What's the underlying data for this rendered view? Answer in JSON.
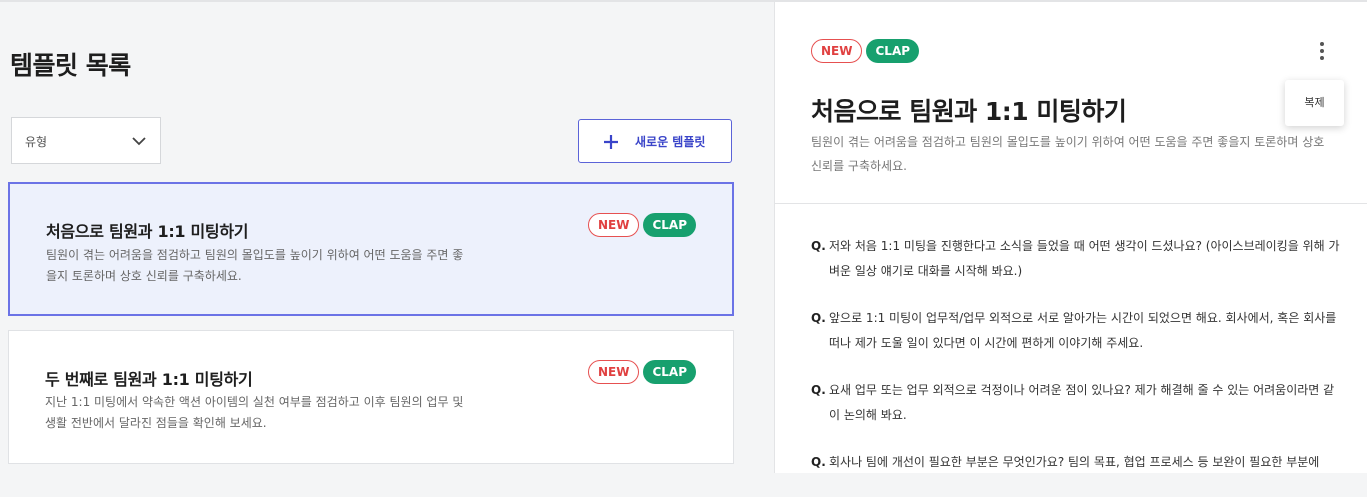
{
  "left": {
    "title": "템플릿 목록",
    "type_select": {
      "label": "유형"
    },
    "new_button": {
      "label": "새로운 템플릿"
    },
    "cards": [
      {
        "title": "처음으로 팀원과 1:1 미팅하기",
        "description": "팀원이 겪는 어려움을 점검하고 팀원의 몰입도를 높이기 위하여 어떤 도움을 주면 좋을지 토론하며 상호 신뢰를 구축하세요.",
        "badge_new": "NEW",
        "badge_clap": "CLAP",
        "selected": true
      },
      {
        "title": "두 번째로 팀원과 1:1 미팅하기",
        "description": "지난 1:1 미팅에서 약속한 액션 아이템의 실천 여부를 점검하고 이후 팀원의 업무 및 생활 전반에서 달라진 점들을 확인해 보세요.",
        "badge_new": "NEW",
        "badge_clap": "CLAP",
        "selected": false
      }
    ]
  },
  "detail": {
    "badge_new": "NEW",
    "badge_clap": "CLAP",
    "menu": {
      "copy_label": "복제"
    },
    "title": "처음으로 팀원과 1:1 미팅하기",
    "description": "팀원이 겪는 어려움을 점검하고 팀원의 몰입도를 높이기 위하여 어떤 도움을 주면 좋을지 토론하며 상호 신뢰를 구축하세요.",
    "question_marker": "Q.",
    "questions": [
      "저와 처음 1:1 미팅을 진행한다고 소식을 들었을 때 어떤 생각이 드셨나요? (아이스브레이킹을 위해 가벼운 일상 얘기로 대화를 시작해 봐요.)",
      "앞으로 1:1 미팅이 업무적/업무 외적으로 서로 알아가는 시간이 되었으면 해요. 회사에서, 혹은 회사를 떠나 제가 도울 일이 있다면 이 시간에 편하게 이야기해 주세요.",
      "요새 업무 또는 업무 외적으로 걱정이나 어려운 점이 있나요? 제가 해결해 줄 수 있는 어려움이라면 같이 논의해 봐요.",
      "회사나 팀에 개선이 필요한 부분은 무엇인가요? 팀의 목표, 협업 프로세스 등 보완이 필요한 부분에"
    ]
  },
  "colors": {
    "accent": "#5b63d8",
    "new_badge": "#e04040",
    "clap_badge": "#17a06e",
    "selected_card_bg": "#edf1fc"
  }
}
